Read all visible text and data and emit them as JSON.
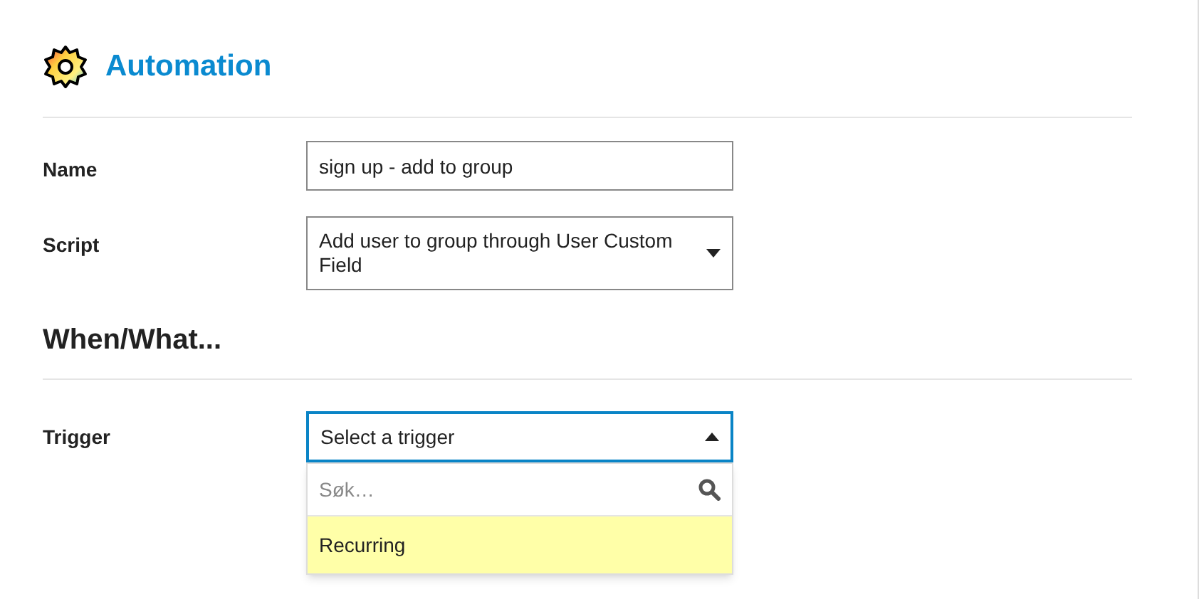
{
  "header": {
    "title": "Automation"
  },
  "fields": [
    {
      "label": "Name",
      "kind": "text",
      "value": "sign up - add to group"
    },
    {
      "label": "Script",
      "kind": "select",
      "value": "Add user to group through User Custom Field"
    }
  ],
  "section": {
    "title": "When/What..."
  },
  "trigger": {
    "label": "Trigger",
    "value": "Select a trigger",
    "expanded": true,
    "search": {
      "placeholder": "Søk…"
    },
    "options": [
      {
        "label": "Recurring",
        "highlighted": true
      }
    ]
  }
}
